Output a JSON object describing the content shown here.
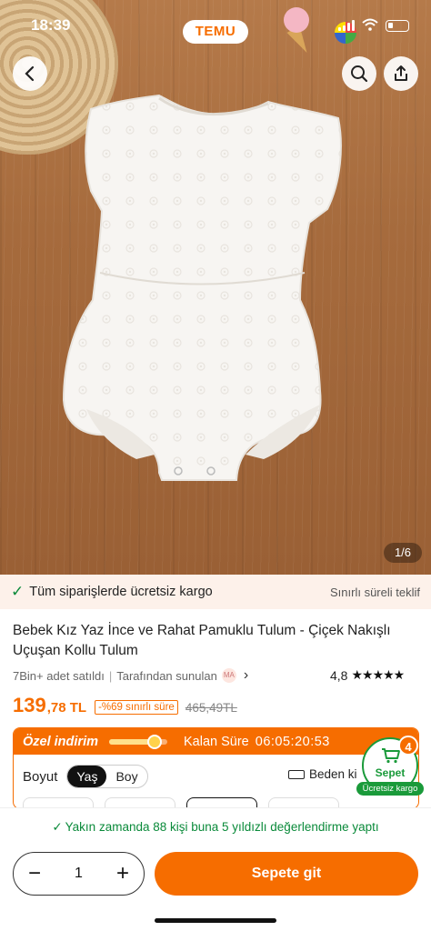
{
  "status_bar": {
    "time": "18:39",
    "app_logo": "TEMU"
  },
  "gallery": {
    "counter": "1/6"
  },
  "promo": {
    "icon": "check-icon",
    "left_text": "Tüm siparişlerde ücretsiz kargo",
    "right_text": "Sınırlı süreli teklif"
  },
  "product": {
    "title": "Bebek Kız Yaz İnce ve Rahat Pamuklu Tulum - Çiçek Nakışlı Uçuşan Kollu Tulum",
    "sold": "7Bin+ adet satıldı",
    "seller_text": "Tarafından sunulan",
    "seller_badge": "MA",
    "rating": "4,8",
    "stars": "★★★★★",
    "price_main": "139",
    "price_dec": ",78 TL",
    "discount": "-%69 sınırlı süre",
    "old_price": "465,49TL"
  },
  "special_offer": {
    "label": "Özel indirim",
    "progress": 0.78,
    "remaining_label": "Kalan Süre",
    "timer": "06:05:20:53",
    "size_label": "Boyut",
    "size_options": [
      "Yaş",
      "Boy"
    ],
    "selected_option": "Yaş",
    "size_guide": "Beden ki"
  },
  "cart": {
    "count": "4",
    "label": "Sepet",
    "free_shipping": "Ücretsiz kargo"
  },
  "bottom": {
    "social_proof": "Yakın zamanda 88 kişi buna 5 yıldızlı değerlendirme yaptı",
    "quantity": "1",
    "cta_label": "Sepete git"
  },
  "colors": {
    "accent": "#f66d00",
    "success": "#0a8a3a",
    "promo_bg": "#fdf1ea"
  }
}
